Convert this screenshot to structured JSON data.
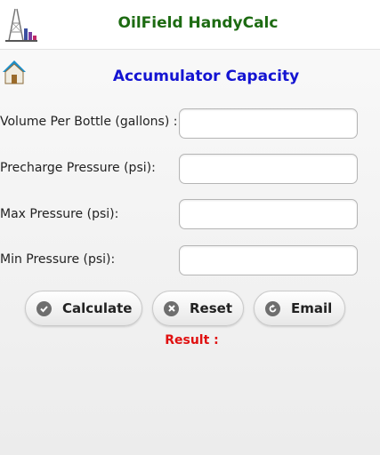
{
  "header": {
    "app_title": "OilField HandyCalc",
    "logo_icon": "oil-derrick-icon"
  },
  "page": {
    "title": "Accumulator Capacity",
    "home_icon": "home-icon"
  },
  "fields": [
    {
      "label": "Volume Per Bottle (gallons) :",
      "value": ""
    },
    {
      "label": "Precharge Pressure (psi):",
      "value": ""
    },
    {
      "label": "Max Pressure (psi):",
      "value": ""
    },
    {
      "label": "Min Pressure (psi):",
      "value": ""
    }
  ],
  "buttons": {
    "calculate": {
      "label": "Calculate",
      "icon": "check-icon"
    },
    "reset": {
      "label": "Reset",
      "icon": "x-icon"
    },
    "email": {
      "label": "Email",
      "icon": "refresh-icon"
    }
  },
  "result": {
    "label": "Result :"
  },
  "colors": {
    "app_title": "#1d6b12",
    "page_title": "#1414d2",
    "result": "#e01010"
  }
}
